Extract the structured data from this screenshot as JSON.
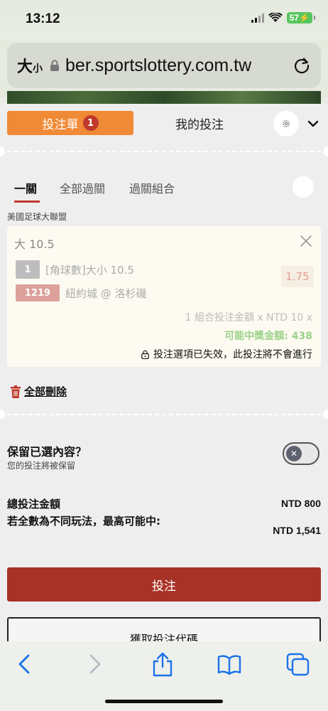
{
  "status": {
    "time": "13:12",
    "battery": "57"
  },
  "browser": {
    "text_size": "大",
    "text_size_small": "小",
    "url": "ber.sportslottery.com.tw"
  },
  "slip": {
    "tab_betslip": "投注單",
    "badge_count": "1",
    "tab_mybets": "我的投注"
  },
  "subtabs": [
    "一關",
    "全部過關",
    "過關組合"
  ],
  "league": "美國足球大聯盟",
  "selection": {
    "title": "大 10.5",
    "number": "1",
    "market": "[角球數]大小 10.5",
    "odds": "1.75",
    "game_no": "1219",
    "match": "紐約城 @ 洛杉磯",
    "stake_line": "1 組合投注金額 x NTD 10 x",
    "payout_line": "可能中獎金額: 438",
    "warning": "投注選項已失效，此投注將不會進行"
  },
  "delete_all": "全部刪除",
  "keep": {
    "title": "保留已選內容？",
    "subtitle": "您的投注將被保留"
  },
  "totals": {
    "total_label": "總投注金額",
    "total_value": "NTD 800",
    "max_label": "若全數為不同玩法，最高可能中:",
    "max_value": "NTD 1,541"
  },
  "buttons": {
    "place_bet": "投注",
    "get_code": "獲取投注代碼"
  },
  "colors": {
    "accent": "#f08a36",
    "primary": "#a93226",
    "payout": "#9bd18a"
  }
}
